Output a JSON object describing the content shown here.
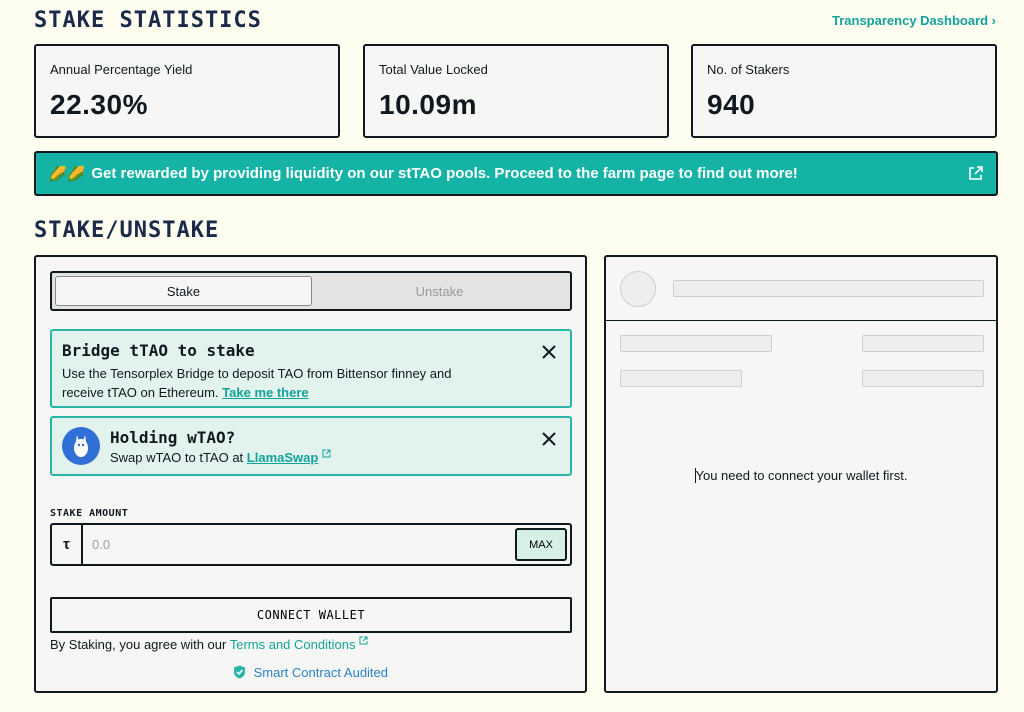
{
  "header": {
    "stats_title": "STAKE STATISTICS",
    "transparency_link": "Transparency Dashboard ›"
  },
  "stats": [
    {
      "label": "Annual Percentage Yield",
      "value": "22.30%"
    },
    {
      "label": "Total Value Locked",
      "value": "10.09m"
    },
    {
      "label": "No. of Stakers",
      "value": "940"
    }
  ],
  "banner": {
    "emoji": "🌽🌽",
    "text": "Get rewarded by providing liquidity on our stTAO pools. Proceed to the farm page to find out more!"
  },
  "stake_section": {
    "title": "STAKE/UNSTAKE",
    "tabs": [
      {
        "label": "Stake",
        "active": true
      },
      {
        "label": "Unstake",
        "active": false
      }
    ],
    "bridge_card": {
      "title": "Bridge tTAO to stake",
      "desc_prefix": "Use the Tensorplex Bridge to deposit TAO from Bittensor finney and receive tTAO on Ethereum.",
      "link": "Take me there"
    },
    "wtao_card": {
      "title": "Holding wTAO?",
      "desc_prefix": "Swap wTAO to tTAO at",
      "link": "LlamaSwap"
    },
    "amount_label": "STAKE AMOUNT",
    "currency_symbol": "τ",
    "amount_placeholder": "0.0",
    "max_label": "MAX",
    "connect_label": "CONNECT WALLET",
    "terms_prefix": "By Staking, you agree with our",
    "terms_link": "Terms and Conditions",
    "audited_label": "Smart Contract Audited"
  },
  "wallet_panel": {
    "message": "You need to connect your wallet first."
  },
  "colors": {
    "background": "#fdfdf0",
    "accent": "#14b3a6",
    "link": "#14a39a",
    "audited": "#2a82c6"
  }
}
